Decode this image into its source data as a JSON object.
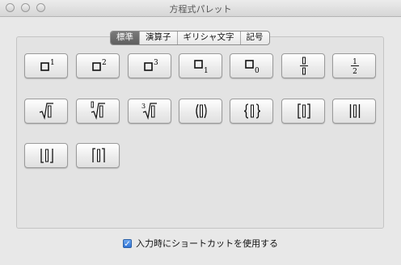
{
  "window": {
    "title": "方程式パレット"
  },
  "tabs": [
    {
      "label": "標準",
      "selected": true
    },
    {
      "label": "演算子",
      "selected": false
    },
    {
      "label": "ギリシャ文字",
      "selected": false
    },
    {
      "label": "記号",
      "selected": false
    }
  ],
  "palette": {
    "buttons": [
      {
        "name": "superscript-1-button",
        "icon": "box-superscript-1"
      },
      {
        "name": "superscript-2-button",
        "icon": "box-superscript-2"
      },
      {
        "name": "superscript-3-button",
        "icon": "box-superscript-3"
      },
      {
        "name": "subscript-1-button",
        "icon": "box-subscript-1"
      },
      {
        "name": "subscript-0-button",
        "icon": "box-subscript-0"
      },
      {
        "name": "fraction-button",
        "icon": "fraction-template"
      },
      {
        "name": "fraction-1-2-button",
        "icon": "fraction-one-half"
      },
      {
        "name": "square-root-button",
        "icon": "sqrt"
      },
      {
        "name": "nth-root-button",
        "icon": "nth-root"
      },
      {
        "name": "cube-root-button",
        "icon": "cube-root"
      },
      {
        "name": "parentheses-button",
        "icon": "parentheses"
      },
      {
        "name": "braces-button",
        "icon": "braces"
      },
      {
        "name": "brackets-button",
        "icon": "square-brackets"
      },
      {
        "name": "absolute-value-button",
        "icon": "vertical-bars"
      },
      {
        "name": "floor-button",
        "icon": "floor"
      },
      {
        "name": "ceiling-button",
        "icon": "ceiling"
      }
    ],
    "glyphs": {
      "sup1": "1",
      "sup2": "2",
      "sup3": "3",
      "sub1": "1",
      "sub0": "0",
      "num": "1",
      "den": "2",
      "root3": "3"
    }
  },
  "options": {
    "shortcut_label": "入力時にショートカットを使用する",
    "shortcut_checked": true
  }
}
